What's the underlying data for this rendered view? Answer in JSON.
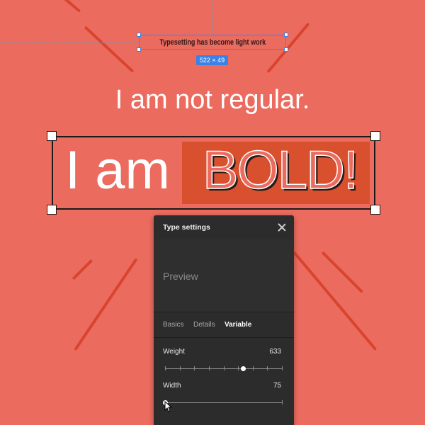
{
  "canvas": {
    "background": "#ec6b5f",
    "ray_color": "#d9442f",
    "selected_text": "Typesetting has become light work",
    "selection_size_badge": "522 × 49",
    "selection_color": "#3b82e6",
    "regular_line": "I am not regular.",
    "bold_prefix": "I am",
    "bold_word": "BOLD!"
  },
  "panel": {
    "title": "Type settings",
    "close_icon": "close-icon",
    "preview_label": "Preview",
    "tabs": [
      {
        "label": "Basics",
        "active": false
      },
      {
        "label": "Details",
        "active": false
      },
      {
        "label": "Variable",
        "active": true
      }
    ],
    "sliders": [
      {
        "label": "Weight",
        "value": "633",
        "fraction": 0.66
      },
      {
        "label": "Width",
        "value": "75",
        "fraction": 0.0
      }
    ]
  }
}
